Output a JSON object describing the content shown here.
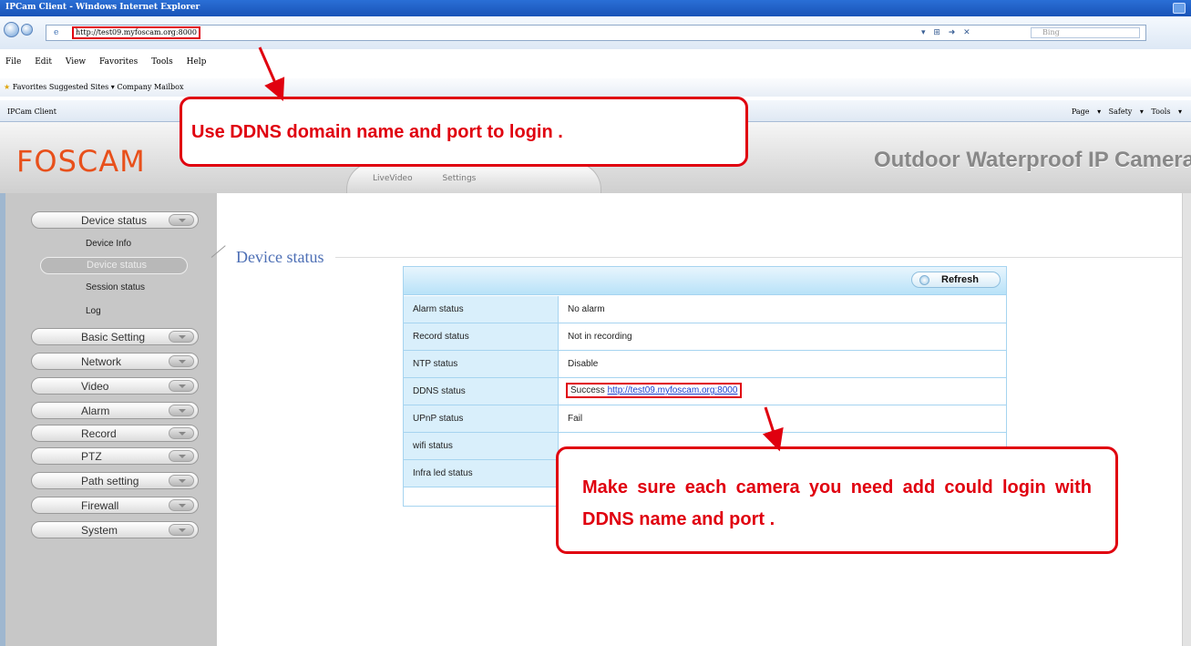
{
  "window": {
    "title": "IPCam Client - Windows Internet Explorer"
  },
  "browser": {
    "address_url": "http://test09.myfoscam.org:8000",
    "search_placeholder": "Bing",
    "menu": "File Edit View Favorites Tools Help",
    "favorites_bar": "Favorites   Suggested Sites ▾   Company Mailbox",
    "tab_title": "IPCam Client",
    "command_bar": "Page ▾ Safety ▾ Tools ▾"
  },
  "header": {
    "logo": "FOSCAM",
    "nav_tabs": "LiveVideo Settings",
    "product_title": "Outdoor Waterproof IP Camera"
  },
  "sidebar": {
    "device_status": "Device status",
    "device_info": "Device Info",
    "device_status_active": "Device status",
    "session_status": "Session status",
    "log": "Log",
    "basic_setting": "Basic Setting",
    "network": "Network",
    "video": "Video",
    "alarm": "Alarm",
    "record": "Record",
    "ptz": "PTZ",
    "path_setting": "Path setting",
    "firewall": "Firewall",
    "system": "System"
  },
  "main": {
    "section_title": "Device status",
    "refresh_label": "Refresh",
    "rows": [
      {
        "label": "Alarm status",
        "value": "No alarm"
      },
      {
        "label": "Record status",
        "value": "Not in recording"
      },
      {
        "label": "NTP status",
        "value": "Disable"
      },
      {
        "label": "DDNS status",
        "value": "Success",
        "link": "http://test09.myfoscam.org:8000"
      },
      {
        "label": "UPnP status",
        "value": "Fail"
      },
      {
        "label": "wifi status",
        "value": ""
      },
      {
        "label": "Infra led status",
        "value": ""
      }
    ]
  },
  "annotations": {
    "callout_login": "Use DDNS domain name and port to login .",
    "callout_camera": "Make sure each camera you need add could login with DDNS name and port ."
  },
  "colors": {
    "annotation": "#e0000f",
    "logo": "#e8501b",
    "table_border": "#a6d4f0",
    "section_title": "#4d6fb5"
  }
}
